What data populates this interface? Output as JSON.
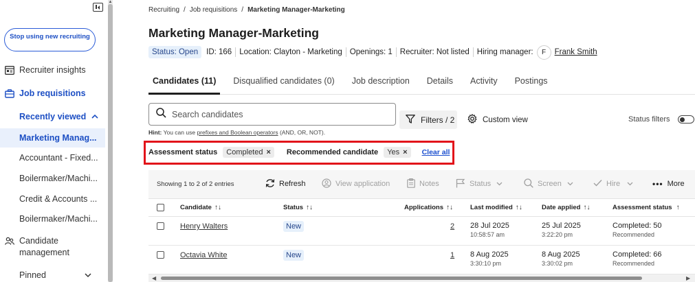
{
  "sidebar": {
    "stop_btn": "Stop using new recruiting",
    "items": [
      {
        "label": "Recruiter insights"
      },
      {
        "label": "Job requisitions"
      },
      {
        "label": "Recently viewed"
      },
      {
        "label": "Candidate management"
      },
      {
        "label": "Pinned"
      }
    ],
    "recent": [
      "Marketing Manag...",
      "Accountant - Fixed...",
      "Boilermaker/Machi...",
      "Credit & Accounts ...",
      "Boilermaker/Machi..."
    ]
  },
  "breadcrumb": {
    "items": [
      "Recruiting",
      "Job requisitions",
      "Marketing Manager-Marketing"
    ],
    "sep": "/"
  },
  "page_title": "Marketing Manager-Marketing",
  "meta": {
    "status": "Status: Open",
    "id": "ID: 166",
    "location": "Location: Clayton - Marketing",
    "openings": "Openings: 1",
    "recruiter": "Recruiter: Not listed",
    "hiring_manager_label": "Hiring manager:",
    "hm_initial": "F",
    "hm_name": "Frank Smith"
  },
  "tabs": [
    "Candidates (11)",
    "Disqualified candidates (0)",
    "Job description",
    "Details",
    "Activity",
    "Postings"
  ],
  "search": {
    "placeholder": "Search candidates"
  },
  "hint": {
    "label": "Hint:",
    "pre": "You can use",
    "link": "prefixes and Boolean operators",
    "post": "(AND, OR, NOT)."
  },
  "filters_btn": "Filters / 2",
  "custom_view": "Custom view",
  "status_filters": "Status filters",
  "active_filters": {
    "assessment_label": "Assessment status",
    "assessment_value": "Completed",
    "recommended_label": "Recommended candidate",
    "recommended_value": "Yes",
    "clear_all": "Clear all",
    "remove_glyph": "×"
  },
  "toolbar": {
    "showing": "Showing 1 to 2 of 2 entries",
    "refresh": "Refresh",
    "view_application": "View application",
    "notes": "Notes",
    "status": "Status",
    "screen": "Screen",
    "hire": "Hire",
    "more": "More"
  },
  "table": {
    "headers": [
      "Candidate",
      "Status",
      "Applications",
      "Last modified",
      "Date applied",
      "Assessment status"
    ],
    "sort_glyph": "↑↓",
    "sort_asc_glyph": "↑",
    "rows": [
      {
        "name": "Henry Walters",
        "status": "New",
        "applications": "2",
        "modified_date": "28 Jul 2025",
        "modified_time": "10:58:57 am",
        "applied_date": "25 Jul 2025",
        "applied_time": "3:22:20 pm",
        "assessment": "Completed: 50",
        "assessment_sub": "Recommended"
      },
      {
        "name": "Octavia White",
        "status": "New",
        "applications": "1",
        "modified_date": "8 Aug 2025",
        "modified_time": "3:30:10 pm",
        "applied_date": "8 Aug 2025",
        "applied_time": "3:30:02 pm",
        "assessment": "Completed: 66",
        "assessment_sub": "Recommended"
      }
    ]
  },
  "colors": {
    "accent": "#1b4fcf",
    "highlight": "#e2131a",
    "status_bg": "#e6f0fb"
  }
}
